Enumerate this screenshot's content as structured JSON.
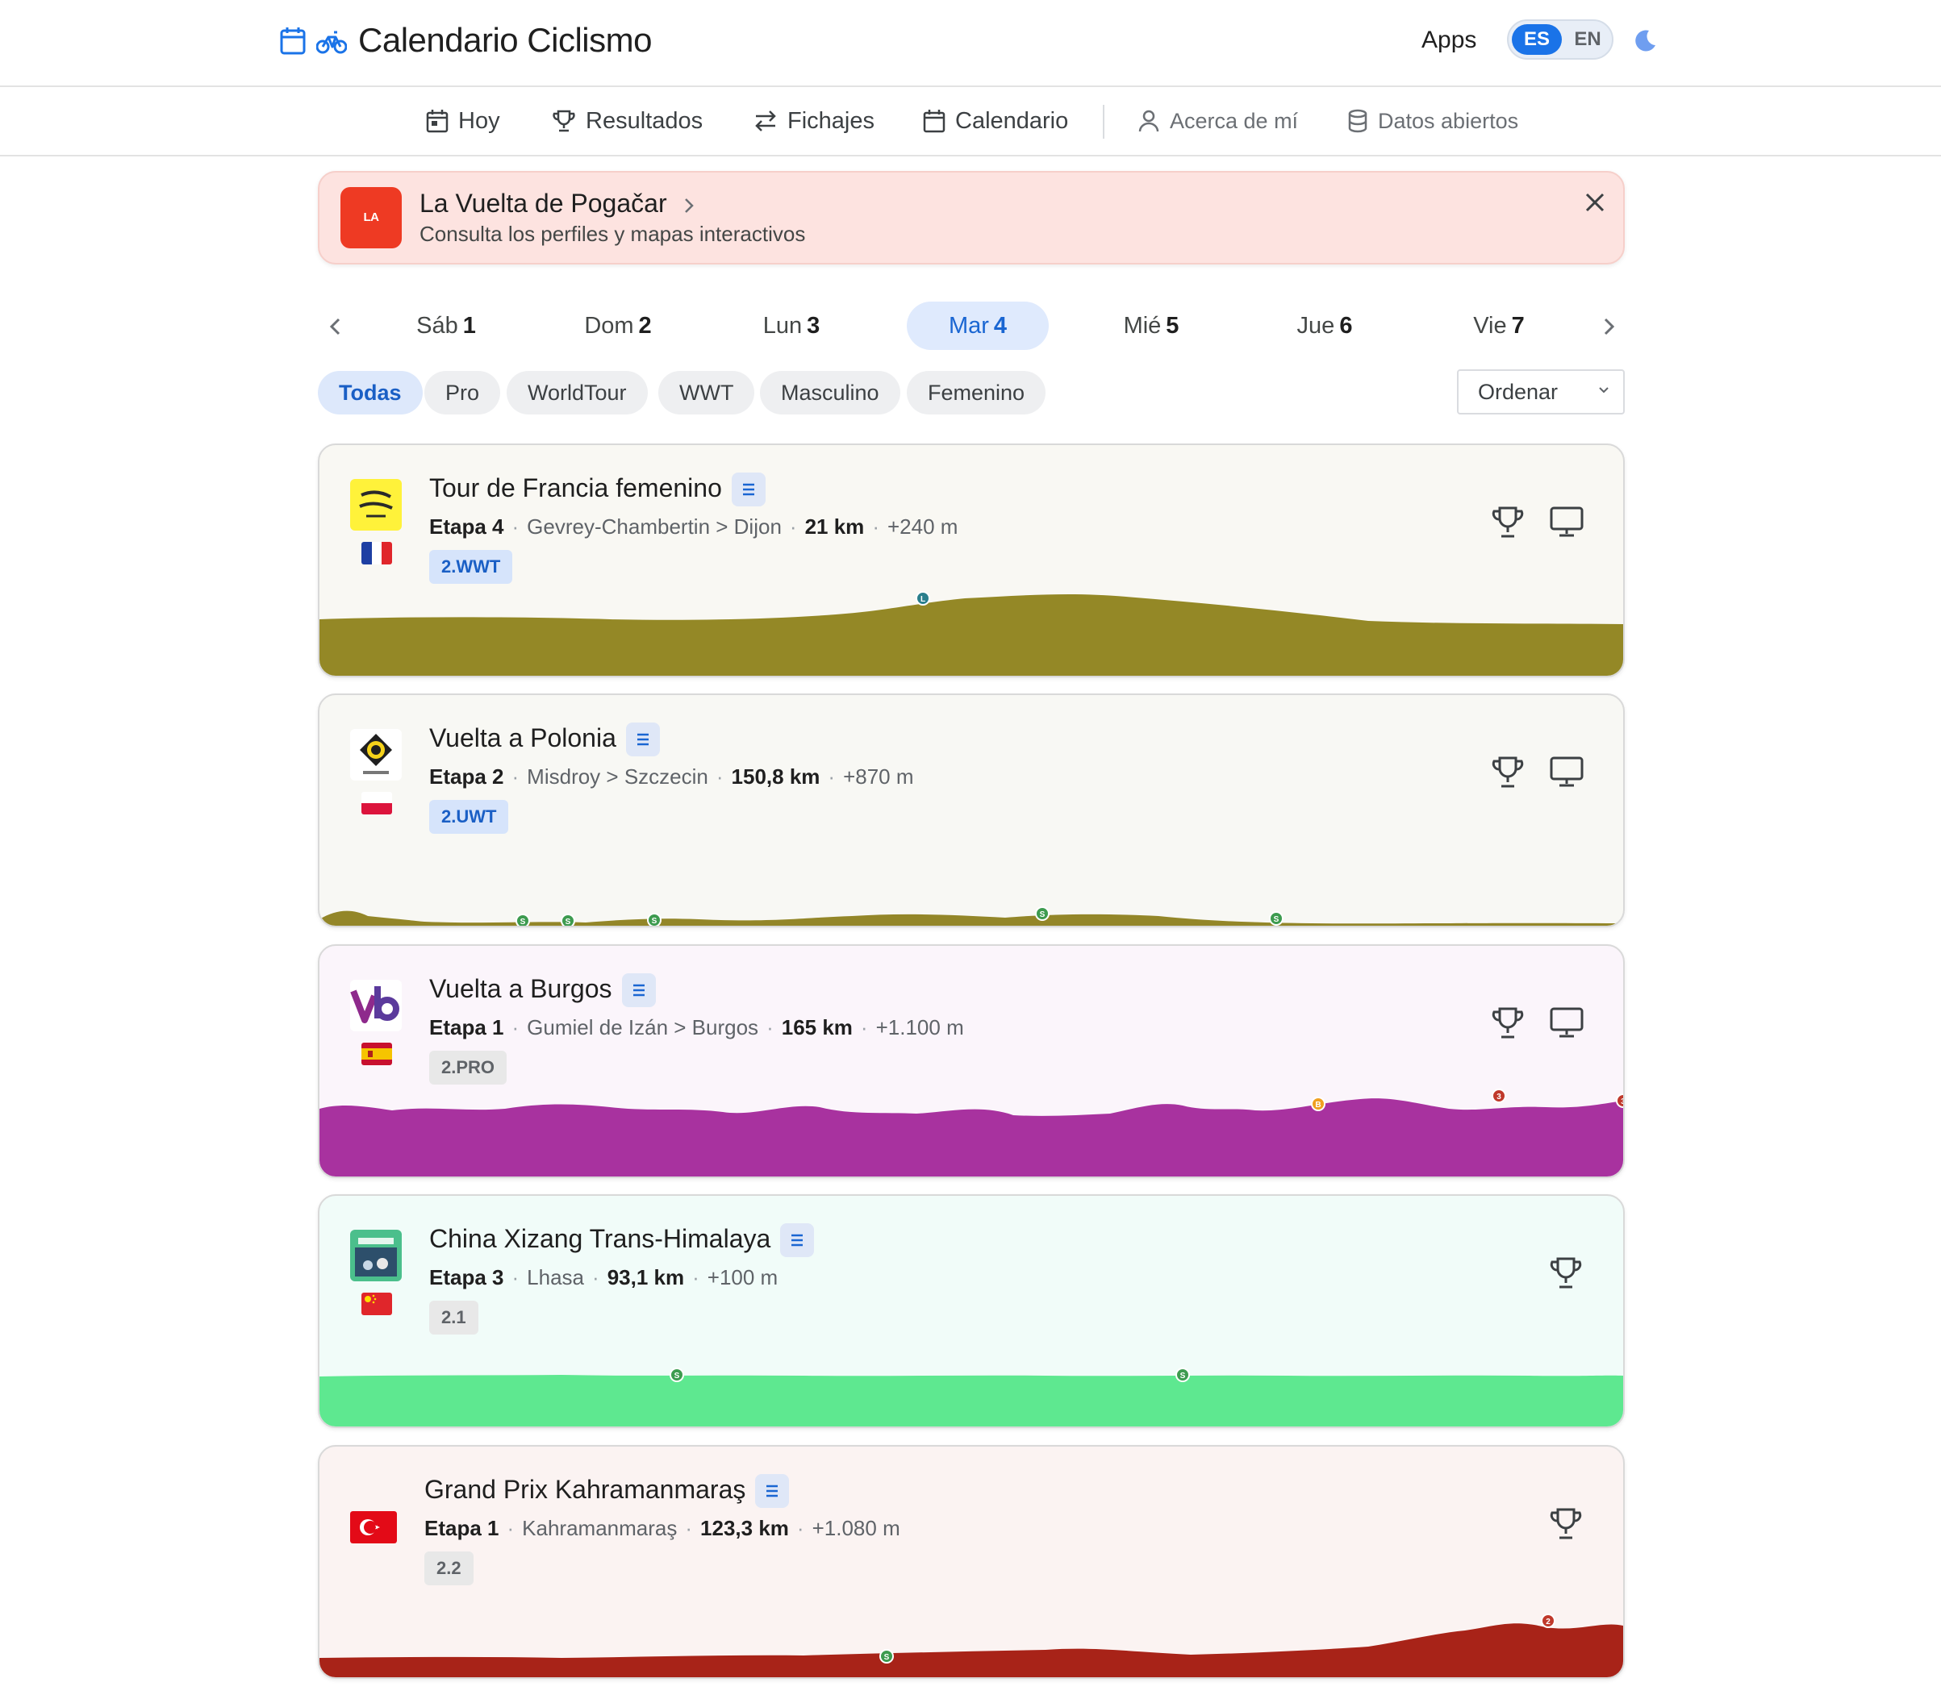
{
  "header": {
    "title": "Calendario Ciclismo",
    "apps_label": "Apps",
    "lang_es": "ES",
    "lang_en": "EN"
  },
  "nav": {
    "today": "Hoy",
    "results": "Resultados",
    "transfers": "Fichajes",
    "calendar": "Calendario",
    "about": "Acerca de mí",
    "open_data": "Datos abiertos"
  },
  "banner": {
    "logo_text": "LA VUELTA",
    "title": "La Vuelta de Pogačar",
    "subtitle": "Consulta los perfiles y mapas interactivos"
  },
  "days": [
    {
      "name": "Sáb",
      "num": "1"
    },
    {
      "name": "Dom",
      "num": "2"
    },
    {
      "name": "Lun",
      "num": "3"
    },
    {
      "name": "Mar",
      "num": "4",
      "selected": true
    },
    {
      "name": "Mié",
      "num": "5"
    },
    {
      "name": "Jue",
      "num": "6"
    },
    {
      "name": "Vie",
      "num": "7"
    }
  ],
  "filters": [
    "Todas",
    "Pro",
    "WorldTour",
    "WWT",
    "Masculino",
    "Femenino"
  ],
  "sort_label": "Ordenar",
  "races": [
    {
      "name": "Tour de Francia femenino",
      "stage": "Etapa 4",
      "route": "Gevrey-Chambertin > Dijon",
      "distance": "21 km",
      "elevation": "+240 m",
      "category": "2.WWT",
      "bg": "#f9f8f3",
      "profile_color": "#948826",
      "has_tv": true
    },
    {
      "name": "Vuelta a Polonia",
      "stage": "Etapa 2",
      "route": "Misdroy > Szczecin",
      "distance": "150,8 km",
      "elevation": "+870 m",
      "category": "2.UWT",
      "bg": "#f8f8f4",
      "profile_color": "#938628",
      "has_tv": true
    },
    {
      "name": "Vuelta a Burgos",
      "stage": "Etapa 1",
      "route": "Gumiel de Izán > Burgos",
      "distance": "165 km",
      "elevation": "+1.100 m",
      "category": "2.PRO",
      "bg": "#fbf5fb",
      "profile_color": "#a8329f",
      "has_tv": true
    },
    {
      "name": "China Xizang Trans-Himalaya",
      "stage": "Etapa 3",
      "route": "Lhasa",
      "distance": "93,1 km",
      "elevation": "+100 m",
      "category": "2.1",
      "bg": "#f1fcf9",
      "profile_color": "#5ee890",
      "has_tv": false
    },
    {
      "name": "Grand Prix Kahramanmaraş",
      "stage": "Etapa 1",
      "route": "Kahramanmaraş",
      "distance": "123,3 km",
      "elevation": "+1.080 m",
      "category": "2.2",
      "bg": "#fbf3f2",
      "profile_color": "#a82318",
      "has_tv": false
    }
  ]
}
